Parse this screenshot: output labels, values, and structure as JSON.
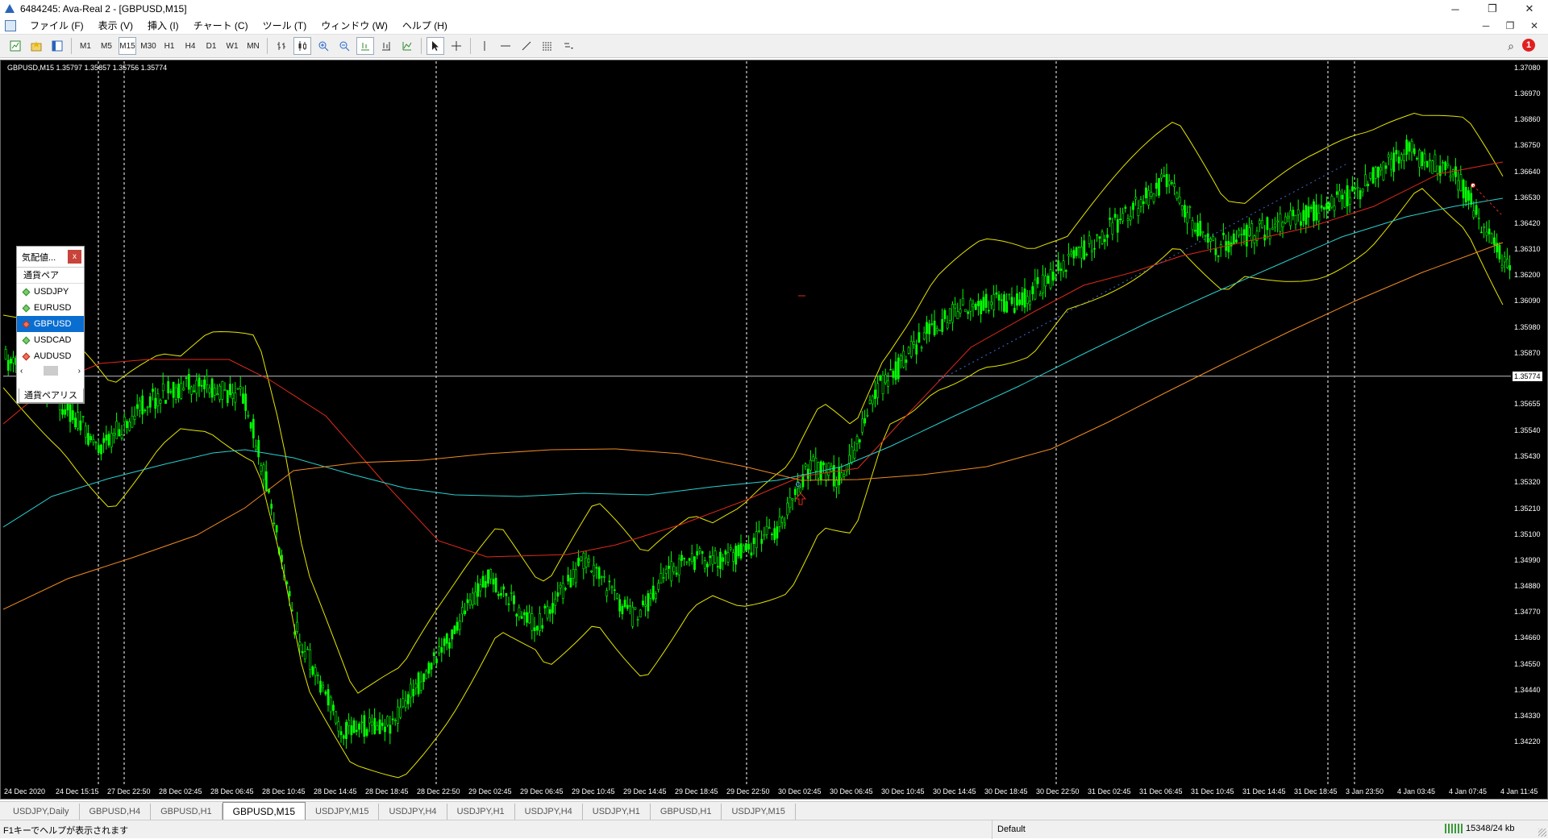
{
  "window": {
    "title": "6484245: Ava-Real 2 - [GBPUSD,M15]"
  },
  "menu": [
    "ファイル (F)",
    "表示 (V)",
    "挿入 (I)",
    "チャート (C)",
    "ツール (T)",
    "ウィンドウ (W)",
    "ヘルプ (H)"
  ],
  "toolbar": {
    "timeframes": [
      "M1",
      "M5",
      "M15",
      "M30",
      "H1",
      "H4",
      "D1",
      "W1",
      "MN"
    ],
    "active_timeframe": "M15",
    "alerts_count": "1"
  },
  "chart": {
    "header": "GBPUSD,M15  1.35797 1.35857 1.35756 1.35774",
    "current_price": "1.35774",
    "background": "#000000",
    "price_labels": [
      "1.37080",
      "1.36970",
      "1.36860",
      "1.36750",
      "1.36640",
      "1.36530",
      "1.36420",
      "1.36310",
      "1.36200",
      "1.36090",
      "1.35980",
      "1.35870",
      "1.35655",
      "1.35540",
      "1.35430",
      "1.35320",
      "1.35210",
      "1.35100",
      "1.34990",
      "1.34880",
      "1.34770",
      "1.34660",
      "1.34550",
      "1.34440",
      "1.34330",
      "1.34220"
    ],
    "time_labels": [
      "24 Dec 2020",
      "24 Dec 15:15",
      "27 Dec 22:50",
      "28 Dec 02:45",
      "28 Dec 06:45",
      "28 Dec 10:45",
      "28 Dec 14:45",
      "28 Dec 18:45",
      "28 Dec 22:50",
      "29 Dec 02:45",
      "29 Dec 06:45",
      "29 Dec 10:45",
      "29 Dec 14:45",
      "29 Dec 18:45",
      "29 Dec 22:50",
      "30 Dec 02:45",
      "30 Dec 06:45",
      "30 Dec 10:45",
      "30 Dec 14:45",
      "30 Dec 18:45",
      "30 Dec 22:50",
      "31 Dec 02:45",
      "31 Dec 06:45",
      "31 Dec 10:45",
      "31 Dec 14:45",
      "31 Dec 18:45",
      "3 Jan 23:50",
      "4 Jan 03:45",
      "4 Jan 07:45",
      "4 Jan 11:45"
    ],
    "colors": {
      "candles": "#00ff00",
      "bollinger": "#e6e600",
      "ma_red": "#e02a1a",
      "ma_cyan": "#2ad0d0",
      "ma_orange": "#f08a20",
      "grid": "#ffffff"
    }
  },
  "market_watch": {
    "title": "気配値...",
    "close_label": "x",
    "column": "通貨ペア",
    "symbols": [
      "USDJPY",
      "EURUSD",
      "GBPUSD",
      "USDCAD",
      "AUDUSD"
    ],
    "selected": "GBPUSD",
    "tab": "通貨ペアリスト"
  },
  "tabs": [
    "USDJPY,Daily",
    "GBPUSD,H4",
    "GBPUSD,H1",
    "GBPUSD,M15",
    "USDJPY,M15",
    "USDJPY,H4",
    "USDJPY,H1",
    "USDJPY,H4",
    "USDJPY,H1",
    "GBPUSD,H1",
    "USDJPY,M15"
  ],
  "active_tab": "GBPUSD,M15",
  "status": {
    "hint": "F1キーでヘルプが表示されます",
    "profile": "Default",
    "connection": "15348/24 kb"
  }
}
